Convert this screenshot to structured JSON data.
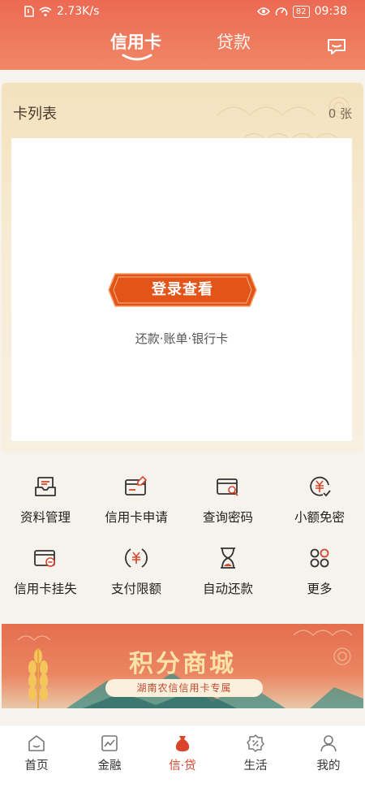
{
  "status_bar": {
    "network_speed": "2.73K/s",
    "battery": "82",
    "time": "09:38"
  },
  "header": {
    "tabs": [
      {
        "label": "信用卡",
        "active": true
      },
      {
        "label": "贷款",
        "active": false
      }
    ],
    "message_icon": "message-icon"
  },
  "card_list": {
    "title": "卡列表",
    "count": "0 张",
    "login_button": "登录查看",
    "subtitle": "还款·账单·银行卡"
  },
  "functions": [
    {
      "label": "资料管理",
      "icon": "inbox-icon"
    },
    {
      "label": "信用卡申请",
      "icon": "card-edit-icon"
    },
    {
      "label": "查询密码",
      "icon": "card-search-icon"
    },
    {
      "label": "小额免密",
      "icon": "yen-check-icon"
    },
    {
      "label": "信用卡挂失",
      "icon": "card-minus-icon"
    },
    {
      "label": "支付限额",
      "icon": "yen-limit-icon"
    },
    {
      "label": "自动还款",
      "icon": "hourglass-icon"
    },
    {
      "label": "更多",
      "icon": "more-grid-icon"
    }
  ],
  "banner": {
    "title": "积分商城",
    "subtitle": "湖南农信信用卡专属"
  },
  "bottom_nav": [
    {
      "label": "首页",
      "icon": "home-icon",
      "active": false
    },
    {
      "label": "金融",
      "icon": "chart-icon",
      "active": false
    },
    {
      "label": "信·贷",
      "icon": "money-bag-icon",
      "active": true
    },
    {
      "label": "生活",
      "icon": "percent-tag-icon",
      "active": false
    },
    {
      "label": "我的",
      "icon": "user-icon",
      "active": false
    }
  ],
  "colors": {
    "header": "#ec6a53",
    "accent": "#d9442a",
    "login_button": "#e25418"
  }
}
